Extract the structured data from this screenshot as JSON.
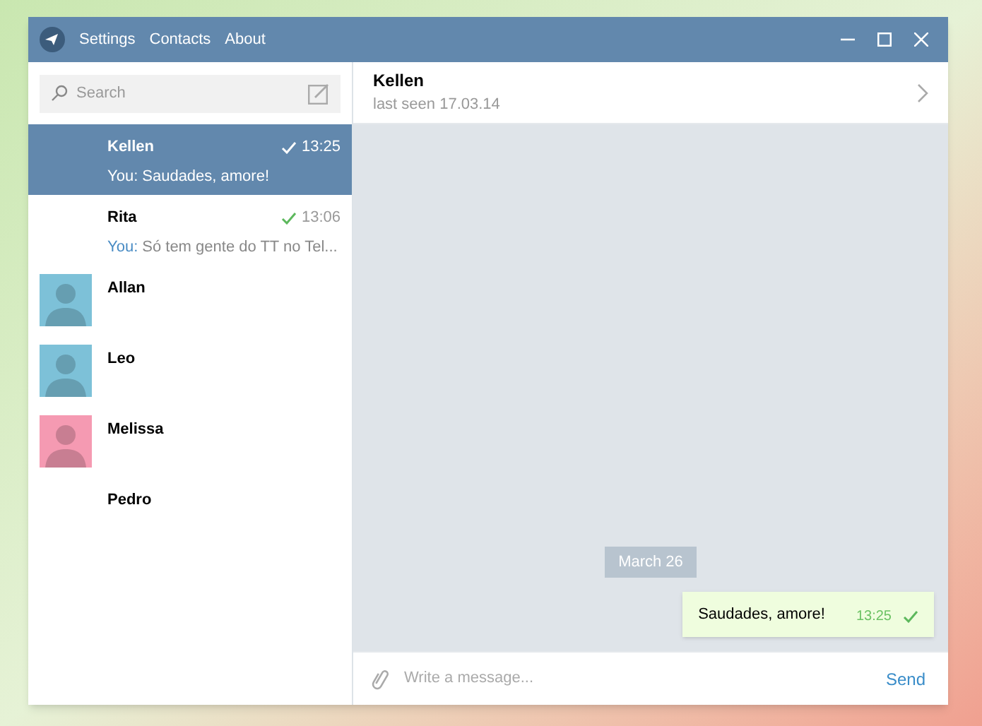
{
  "menu": [
    "Settings",
    "Contacts",
    "About"
  ],
  "search": {
    "placeholder": "Search"
  },
  "chats": [
    {
      "name": "Kellen",
      "selected": true,
      "time": "13:25",
      "read": true,
      "sender": "You:",
      "preview": "Saudades, amore!"
    },
    {
      "name": "Rita",
      "selected": false,
      "time": "13:06",
      "read": true,
      "sender": "You:",
      "preview": "Só tem gente do TT no Tel..."
    },
    {
      "name": "Allan",
      "selected": false,
      "avatar": {
        "kind": "silhouette",
        "color": "#7dc1d8"
      }
    },
    {
      "name": "Leo",
      "selected": false,
      "avatar": {
        "kind": "silhouette",
        "color": "#7dc1d8"
      }
    },
    {
      "name": "Melissa",
      "selected": false,
      "avatar": {
        "kind": "silhouette",
        "color": "#f59ab2"
      }
    },
    {
      "name": "Pedro",
      "selected": false
    }
  ],
  "header": {
    "name": "Kellen",
    "status": "last seen 17.03.14"
  },
  "date_label": "March 26",
  "messages": [
    {
      "text": "Saudades, amore!",
      "time": "13:25",
      "read": true
    }
  ],
  "composer": {
    "placeholder": "Write a message...",
    "send": "Send"
  }
}
